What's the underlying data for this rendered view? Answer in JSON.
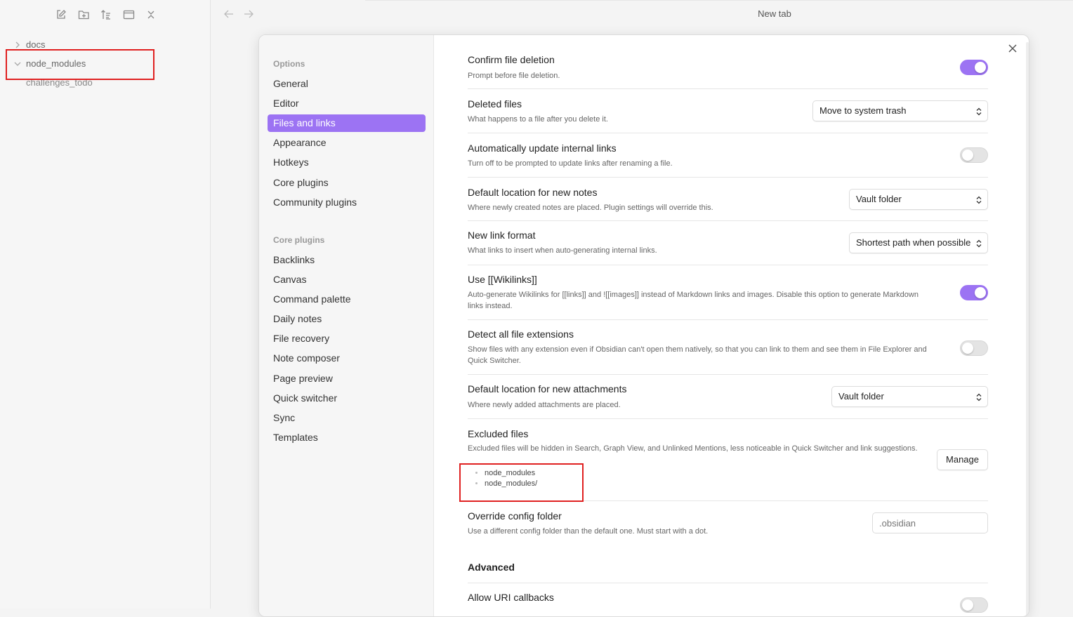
{
  "explorer": {
    "toolbar": [
      "new-note-icon",
      "new-folder-icon",
      "sort-icon",
      "collapse-all-icon",
      "close-icon"
    ],
    "tree": [
      {
        "label": "docs",
        "expanded": false
      },
      {
        "label": "node_modules",
        "expanded": true
      },
      {
        "label": "challenges_todo",
        "child": true
      }
    ]
  },
  "tab": {
    "title": "New tab"
  },
  "settings": {
    "sidebar": {
      "options_heading": "Options",
      "options": [
        "General",
        "Editor",
        "Files and links",
        "Appearance",
        "Hotkeys",
        "Core plugins",
        "Community plugins"
      ],
      "active": "Files and links",
      "core_heading": "Core plugins",
      "core": [
        "Backlinks",
        "Canvas",
        "Command palette",
        "Daily notes",
        "File recovery",
        "Note composer",
        "Page preview",
        "Quick switcher",
        "Sync",
        "Templates"
      ]
    },
    "items": {
      "confirm_deletion": {
        "name": "Confirm file deletion",
        "desc": "Prompt before file deletion.",
        "on": true
      },
      "deleted_files": {
        "name": "Deleted files",
        "desc": "What happens to a file after you delete it.",
        "value": "Move to system trash"
      },
      "auto_update_links": {
        "name": "Automatically update internal links",
        "desc": "Turn off to be prompted to update links after renaming a file.",
        "on": false
      },
      "new_notes_location": {
        "name": "Default location for new notes",
        "desc": "Where newly created notes are placed. Plugin settings will override this.",
        "value": "Vault folder"
      },
      "link_format": {
        "name": "New link format",
        "desc": "What links to insert when auto-generating internal links.",
        "value": "Shortest path when possible"
      },
      "wikilinks": {
        "name": "Use [[Wikilinks]]",
        "desc": "Auto-generate Wikilinks for [[links]] and ![[images]] instead of Markdown links and images. Disable this option to generate Markdown links instead.",
        "on": true
      },
      "file_extensions": {
        "name": "Detect all file extensions",
        "desc": "Show files with any extension even if Obsidian can't open them natively, so that you can link to them and see them in File Explorer and Quick Switcher.",
        "on": false
      },
      "attachments_location": {
        "name": "Default location for new attachments",
        "desc": "Where newly added attachments are placed.",
        "value": "Vault folder"
      },
      "excluded_files": {
        "name": "Excluded files",
        "desc": "Excluded files will be hidden in Search, Graph View, and Unlinked Mentions, less noticeable in Quick Switcher and link suggestions.",
        "button": "Manage",
        "list": [
          "node_modules",
          "node_modules/"
        ]
      },
      "config_folder": {
        "name": "Override config folder",
        "desc": "Use a different config folder than the default one. Must start with a dot.",
        "placeholder": ".obsidian"
      },
      "advanced_heading": "Advanced",
      "uri_callbacks": {
        "name": "Allow URI callbacks",
        "on": false
      }
    }
  },
  "colors": {
    "accent": "#9c73f3",
    "annotation": "#e02020"
  }
}
